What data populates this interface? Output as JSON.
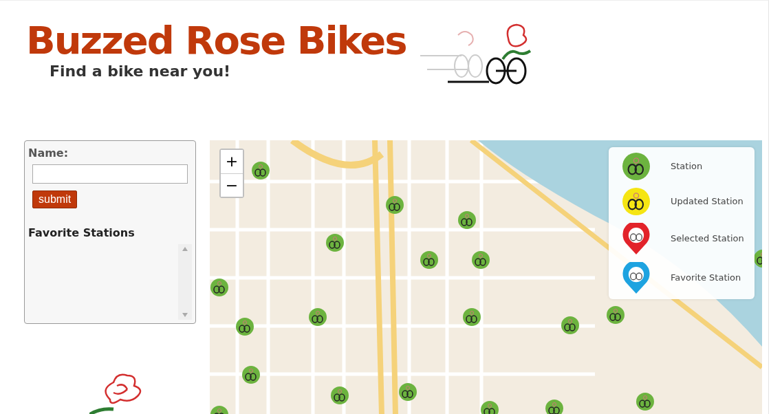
{
  "header": {
    "title": "Buzzed Rose Bikes",
    "tagline": "Find a bike near you!"
  },
  "form": {
    "label": "Name:",
    "submit": "submit"
  },
  "favorites": {
    "title": "Favorite Stations"
  },
  "map": {
    "zoom_in": "+",
    "zoom_out": "−",
    "markers": [
      {
        "kind": "station"
      },
      {
        "kind": "station"
      },
      {
        "kind": "station"
      },
      {
        "kind": "station"
      },
      {
        "kind": "station"
      },
      {
        "kind": "station"
      },
      {
        "kind": "station"
      },
      {
        "kind": "station"
      },
      {
        "kind": "station"
      },
      {
        "kind": "station"
      },
      {
        "kind": "station"
      },
      {
        "kind": "station"
      },
      {
        "kind": "station"
      },
      {
        "kind": "station"
      },
      {
        "kind": "station"
      },
      {
        "kind": "station"
      },
      {
        "kind": "station"
      },
      {
        "kind": "station"
      },
      {
        "kind": "station"
      },
      {
        "kind": "station"
      }
    ],
    "legend": [
      {
        "kind": "circle",
        "label": "Station",
        "color": "#6cb33f"
      },
      {
        "kind": "circle",
        "label": "Updated Station",
        "color": "#f5e513"
      },
      {
        "kind": "pin",
        "label": "Selected Station",
        "color": "#e2232a"
      },
      {
        "kind": "pin",
        "label": "Favorite Station",
        "color": "#1ea3e0"
      }
    ]
  }
}
